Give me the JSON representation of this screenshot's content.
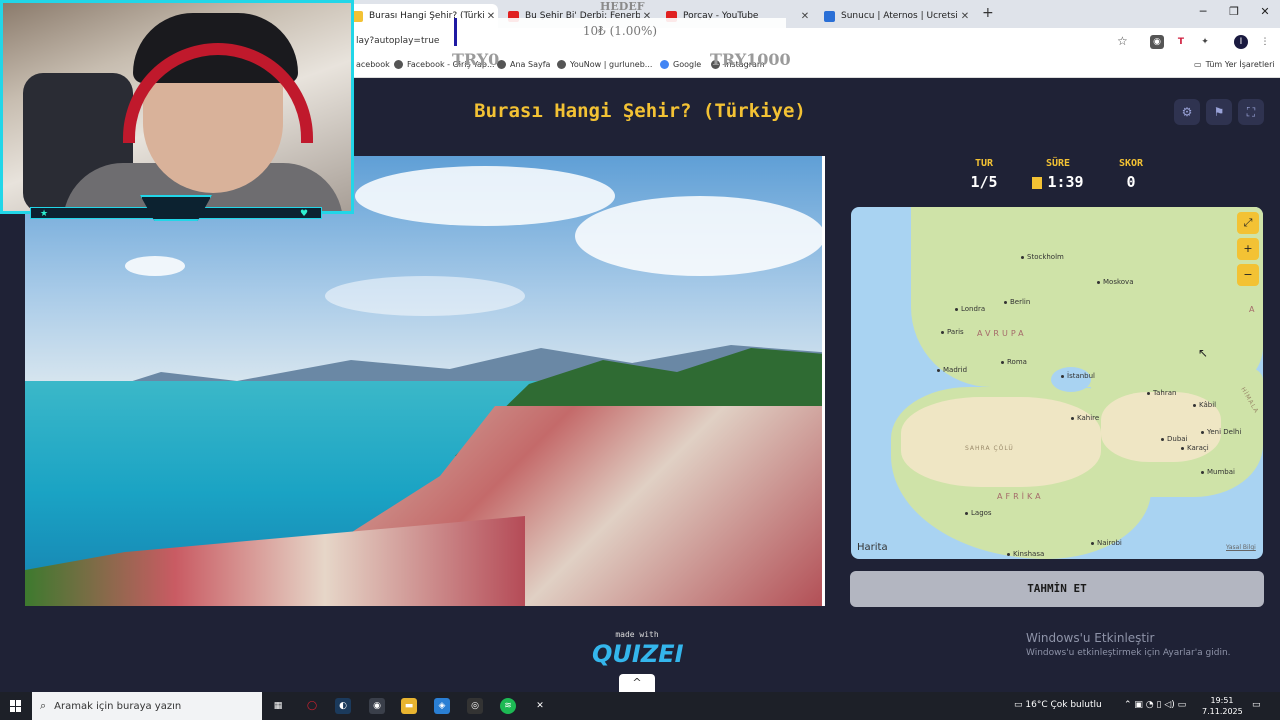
{
  "browser": {
    "tabs": [
      {
        "label": "Burası Hangi Şehir? (Türkiye) - ",
        "active": true,
        "favicon_color": "#f3c234"
      },
      {
        "label": "Bu Şehir Bi' Derbi: Fenerbahçe",
        "active": false,
        "favicon_color": "#e02020"
      },
      {
        "label": "Porçay - YouTube",
        "active": false,
        "favicon_color": "#e02020"
      },
      {
        "label": "Sunucu | Aternos | Ücretsiz Min",
        "active": false,
        "favicon_color": "#2a6fd6"
      }
    ],
    "new_tab": "+",
    "window_controls": {
      "minimize": "─",
      "restore": "❐",
      "close": "✕"
    },
    "url": "lay?autoplay=true",
    "bookmarks": [
      "acebook",
      "Facebook - Giriş Yap...",
      "Ana Sayfa",
      "YouNow | gurluneb...",
      "Google",
      "Instagram"
    ],
    "all_bookmarks": "Tüm Yer İşaretleri"
  },
  "overlay": {
    "hedef": "HEDEF",
    "progress_text": "10₺ (1.00%)",
    "progress_fraction": 0.01,
    "start_label": "TRY0",
    "end_label": "TRY1000"
  },
  "game": {
    "title": "Burası Hangi Şehir? (Türkiye)",
    "tools": {
      "settings": "⚙",
      "flag": "⚑",
      "fullscreen": "⛶"
    },
    "stats": {
      "round_label": "TUR",
      "round_value": "1/5",
      "time_label": "SÜRE",
      "time_value": "1:39",
      "score_label": "SKOR",
      "score_value": "0"
    },
    "map": {
      "cities": [
        "Stockholm",
        "Moskova",
        "Londra",
        "Berlin",
        "Paris",
        "Madrid",
        "Roma",
        "İstanbul",
        "Tahran",
        "Kâbil",
        "Kahire",
        "Dubai",
        "Karaçi",
        "Yeni Delhi",
        "Mumbai",
        "Lagos",
        "Nairobi",
        "Kinshasa"
      ],
      "regions": {
        "europe": "AVRUPA",
        "africa": "AFRİKA",
        "sahara": "SAHRA ÇÖLÜ",
        "himalaya": "HİMALA",
        "asia_edge": "A"
      },
      "controls": {
        "expand": "⤢",
        "zoom_in": "+",
        "zoom_out": "−"
      },
      "brand": "Harita",
      "legal": "Yasal Bilgi"
    },
    "guess_button": "TAHMİN ET",
    "made_with": "made with",
    "logo": "QUIZEI",
    "scroll_up": "^"
  },
  "windows_activation": {
    "title": "Windows'u Etkinleştir",
    "subtitle": "Windows'u etkinleştirmek için Ayarlar'a gidin."
  },
  "taskbar": {
    "search_placeholder": "Aramak için buraya yazın",
    "weather": "16°C  Çok bulutlu",
    "time": "19:51",
    "date": "7.11.2025"
  }
}
